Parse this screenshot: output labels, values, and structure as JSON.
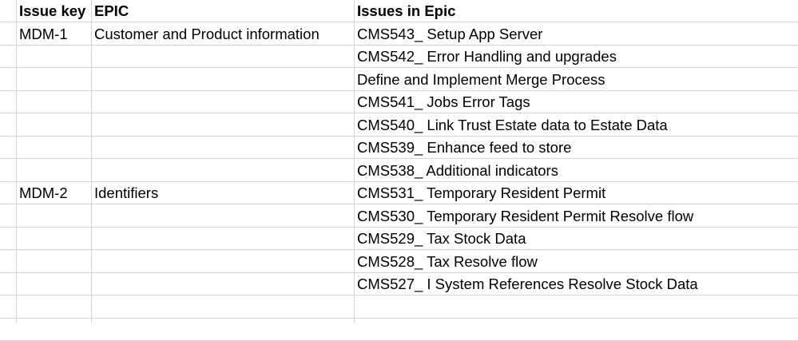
{
  "columns": {
    "issue_key": "Issue key",
    "epic": "EPIC",
    "issues": "Issues in Epic"
  },
  "rows": [
    {
      "issue_key": "MDM-1",
      "epic": "Customer and Product information",
      "issue": "CMS543_ Setup App Server"
    },
    {
      "issue_key": "",
      "epic": "",
      "issue": "CMS542_ Error Handling and upgrades"
    },
    {
      "issue_key": "",
      "epic": "",
      "issue": "Define and Implement Merge Process"
    },
    {
      "issue_key": "",
      "epic": "",
      "issue": "CMS541_ Jobs Error Tags"
    },
    {
      "issue_key": "",
      "epic": "",
      "issue": "CMS540_ Link Trust Estate data to Estate Data"
    },
    {
      "issue_key": "",
      "epic": "",
      "issue": "CMS539_ Enhance feed to store"
    },
    {
      "issue_key": "",
      "epic": "",
      "issue": "CMS538_ Additional indicators"
    },
    {
      "issue_key": "MDM-2",
      "epic": "Identifiers",
      "issue": "CMS531_ Temporary Resident Permit"
    },
    {
      "issue_key": "",
      "epic": "",
      "issue": "CMS530_ Temporary Resident Permit Resolve flow"
    },
    {
      "issue_key": "",
      "epic": "",
      "issue": "CMS529_  Tax Stock Data"
    },
    {
      "issue_key": "",
      "epic": "",
      "issue": "CMS528_  Tax Resolve flow"
    },
    {
      "issue_key": "",
      "epic": "",
      "issue": "CMS527_ I System References Resolve Stock Data"
    }
  ]
}
